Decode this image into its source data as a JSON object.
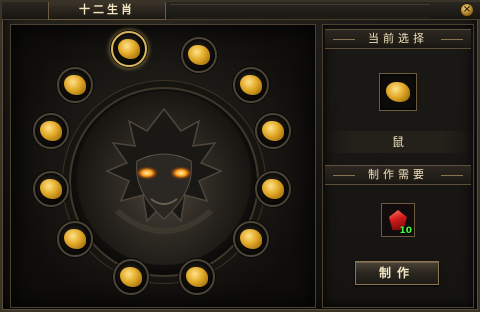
{
  "window": {
    "title": "十二生肖",
    "close_icon": "×"
  },
  "wheel": {
    "selected": "rat",
    "slots": [
      {
        "id": "rat",
        "icon": "rat-icon"
      },
      {
        "id": "ox",
        "icon": "ox-icon"
      },
      {
        "id": "tiger",
        "icon": "tiger-icon"
      },
      {
        "id": "rabbit",
        "icon": "rabbit-icon"
      },
      {
        "id": "dragon",
        "icon": "dragon-icon"
      },
      {
        "id": "snake",
        "icon": "snake-icon"
      },
      {
        "id": "horse",
        "icon": "horse-icon"
      },
      {
        "id": "goat",
        "icon": "goat-icon"
      },
      {
        "id": "monkey",
        "icon": "monkey-icon"
      },
      {
        "id": "rooster",
        "icon": "rooster-icon"
      },
      {
        "id": "dog",
        "icon": "dog-icon"
      },
      {
        "id": "pig",
        "icon": "pig-icon"
      }
    ]
  },
  "right_panel": {
    "current_header": "当前选择",
    "current_name": "鼠",
    "require_header": "制作需要",
    "require_item": {
      "icon": "red-crystal-icon",
      "count": "10"
    },
    "craft_button": "制作"
  },
  "colors": {
    "gold": "#e0a724",
    "selected_glow": "#e8c66a",
    "count_green": "#3cff3c"
  }
}
